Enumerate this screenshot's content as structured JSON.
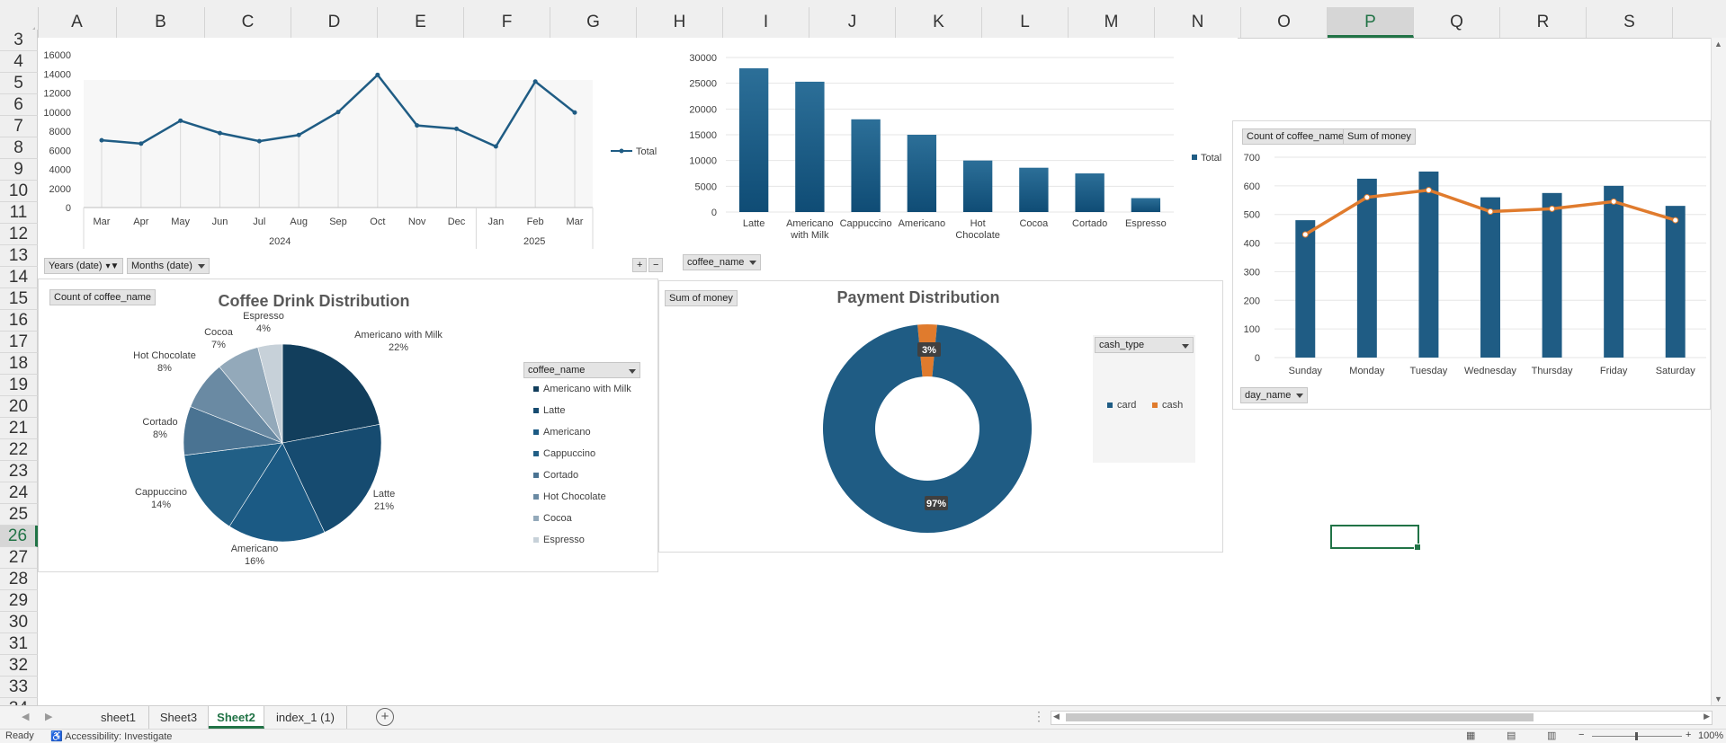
{
  "columns": [
    "A",
    "B",
    "C",
    "D",
    "E",
    "F",
    "G",
    "H",
    "I",
    "J",
    "K",
    "L",
    "M",
    "N",
    "O",
    "P",
    "Q",
    "R",
    "S"
  ],
  "rows": [
    "3",
    "4",
    "5",
    "6",
    "7",
    "8",
    "9",
    "10",
    "11",
    "12",
    "13",
    "14",
    "15",
    "16",
    "17",
    "18",
    "19",
    "20",
    "21",
    "22",
    "23",
    "24",
    "25",
    "26",
    "27",
    "28",
    "29",
    "30",
    "31",
    "32",
    "33",
    "34"
  ],
  "selected_column": "P",
  "selected_row": "26",
  "colors": {
    "primary": "#1f5c84",
    "dark": "#123e5c",
    "accent": "#e07b2d",
    "excel_green": "#217346"
  },
  "line_chart": {
    "pivot_buttons": [
      "Years (date)",
      "Months (date)"
    ],
    "legend": "Total",
    "chart_data": {
      "type": "line",
      "x": [
        "Mar",
        "Apr",
        "May",
        "Jun",
        "Jul",
        "Aug",
        "Sep",
        "Oct",
        "Nov",
        "Dec",
        "Jan",
        "Feb",
        "Mar"
      ],
      "years": [
        "2024",
        "2025"
      ],
      "series": [
        {
          "name": "Total",
          "values": [
            7050,
            6700,
            9100,
            7800,
            6950,
            7600,
            10000,
            13900,
            8600,
            8250,
            6400,
            13200,
            9950
          ]
        }
      ],
      "yticks": [
        "16000",
        "14000",
        "12000",
        "10000",
        "8000",
        "6000",
        "4000",
        "2000",
        "0"
      ],
      "ylim": [
        0,
        16000
      ],
      "grid": false,
      "legend_position": "right"
    }
  },
  "bar_chart": {
    "pivot_button": "coffee_name",
    "legend": "Total",
    "chart_data": {
      "type": "bar",
      "categories": [
        "Latte",
        "Americano with Milk",
        "Cappuccino",
        "Americano",
        "Hot Chocolate",
        "Cocoa",
        "Cortado",
        "Espresso"
      ],
      "category_lines": [
        [
          "Latte"
        ],
        [
          "Americano",
          "with Milk"
        ],
        [
          "Cappuccino"
        ],
        [
          "Americano"
        ],
        [
          "Hot",
          "Chocolate"
        ],
        [
          "Cocoa"
        ],
        [
          "Cortado"
        ],
        [
          "Espresso"
        ]
      ],
      "series": [
        {
          "name": "Total",
          "values": [
            27900,
            25300,
            18000,
            15000,
            10000,
            8600,
            7500,
            2700
          ]
        }
      ],
      "yticks": [
        "30000",
        "25000",
        "20000",
        "15000",
        "10000",
        "5000",
        "0"
      ],
      "ylim": [
        0,
        30000
      ],
      "grid": true,
      "legend_position": "right"
    }
  },
  "combo_chart": {
    "pivot_buttons": [
      "Count of coffee_name",
      "Sum of money"
    ],
    "axis_button": "day_name",
    "chart_data": {
      "type": "bar",
      "categories": [
        "Sunday",
        "Monday",
        "Tuesday",
        "Wednesday",
        "Thursday",
        "Friday",
        "Saturday"
      ],
      "series": [
        {
          "name": "Count of coffee_name",
          "values": [
            480,
            625,
            650,
            560,
            575,
            600,
            530
          ]
        },
        {
          "name": "Sum of money",
          "values": [
            430,
            560,
            585,
            510,
            520,
            545,
            480
          ]
        }
      ],
      "yticks": [
        "700",
        "600",
        "500",
        "400",
        "300",
        "200",
        "100",
        "0"
      ],
      "ylim": [
        0,
        700
      ],
      "grid": true
    }
  },
  "pie_chart": {
    "pivot_button": "Count of coffee_name",
    "title": "Coffee Drink Distribution",
    "legend_header": "coffee_name",
    "chart_data": {
      "type": "pie",
      "title": "Coffee Drink Distribution",
      "categories": [
        "Americano with Milk",
        "Latte",
        "Americano",
        "Cappuccino",
        "Cortado",
        "Hot Chocolate",
        "Cocoa",
        "Espresso"
      ],
      "values": [
        22,
        21,
        16,
        14,
        8,
        8,
        7,
        4
      ],
      "labels": [
        "22%",
        "21%",
        "16%",
        "14%",
        "8%",
        "8%",
        "7%",
        "4%"
      ],
      "colors": [
        "#123e5c",
        "#164b70",
        "#1b5a84",
        "#215f86",
        "#4a7392",
        "#6a8aa3",
        "#93a9ba",
        "#c7d1d9"
      ],
      "legend_position": "right"
    }
  },
  "donut_chart": {
    "pivot_button": "Sum of money",
    "title": "Payment Distribution",
    "legend_header": "cash_type",
    "chart_data": {
      "type": "pie",
      "title": "Payment Distribution",
      "categories": [
        "card",
        "cash"
      ],
      "values": [
        97,
        3
      ],
      "labels": [
        "97%",
        "3%"
      ],
      "colors": [
        "#1f5c84",
        "#e07b2d"
      ],
      "legend_position": "right"
    }
  },
  "sheet_tabs": [
    "sheet1",
    "Sheet3",
    "Sheet2",
    "index_1 (1)"
  ],
  "active_tab": "Sheet2",
  "add_sheet_label": "+",
  "status": {
    "ready": "Ready",
    "accessibility": "Accessibility: Investigate",
    "zoom": "100%"
  }
}
